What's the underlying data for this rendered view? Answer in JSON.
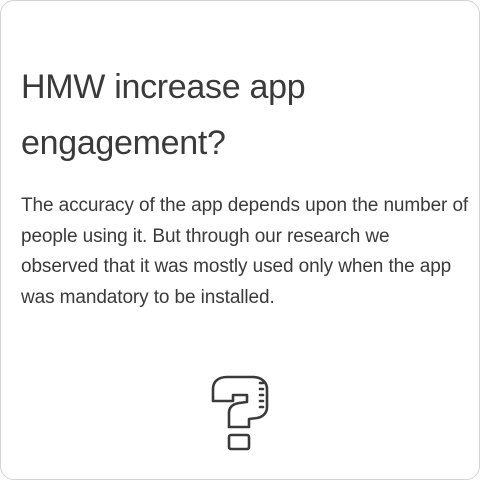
{
  "card": {
    "title": "HMW increase app engagement?",
    "body": "The accuracy of the app depends upon the number of people using it. But through our research we observed that it was mostly used only when the app was mandatory to be installed.",
    "icon": "question-mark-icon"
  },
  "colors": {
    "text": "#3a3a3a",
    "border": "#d4d4d4",
    "background": "#ffffff"
  }
}
